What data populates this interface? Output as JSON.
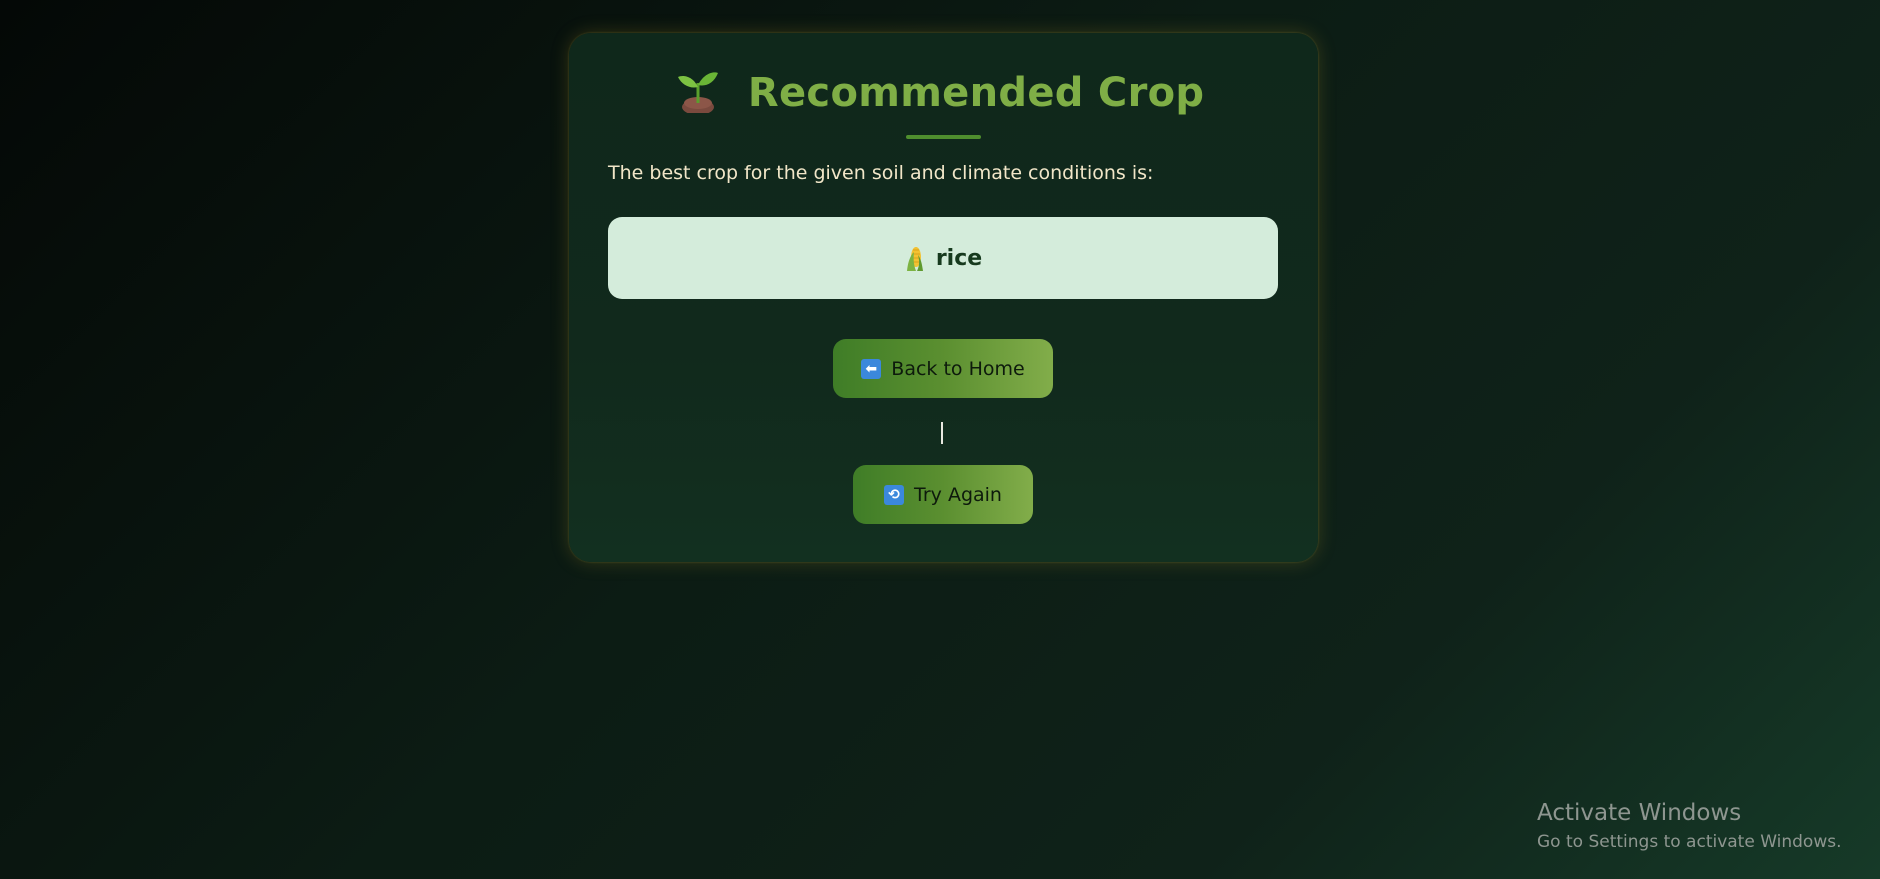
{
  "page": {
    "title": "Recommended Crop",
    "title_icon": "sprout-icon",
    "description": "The best crop for the given soil and climate conditions is:"
  },
  "result": {
    "crop_icon": "corn-icon",
    "crop": "rice"
  },
  "actions": {
    "home_icon": "back-arrow-icon",
    "home_label": "Back to Home",
    "separator": "|",
    "try_icon": "repeat-icon",
    "try_label": "Try Again"
  },
  "watermark": {
    "title": "Activate Windows",
    "subtitle": "Go to Settings to activate Windows."
  },
  "colors": {
    "title": "#7fae46",
    "button_start": "#3f7d27",
    "button_end": "#82ad4a",
    "result_bg": "#d4ecdb",
    "description": "#f1e6c8"
  }
}
